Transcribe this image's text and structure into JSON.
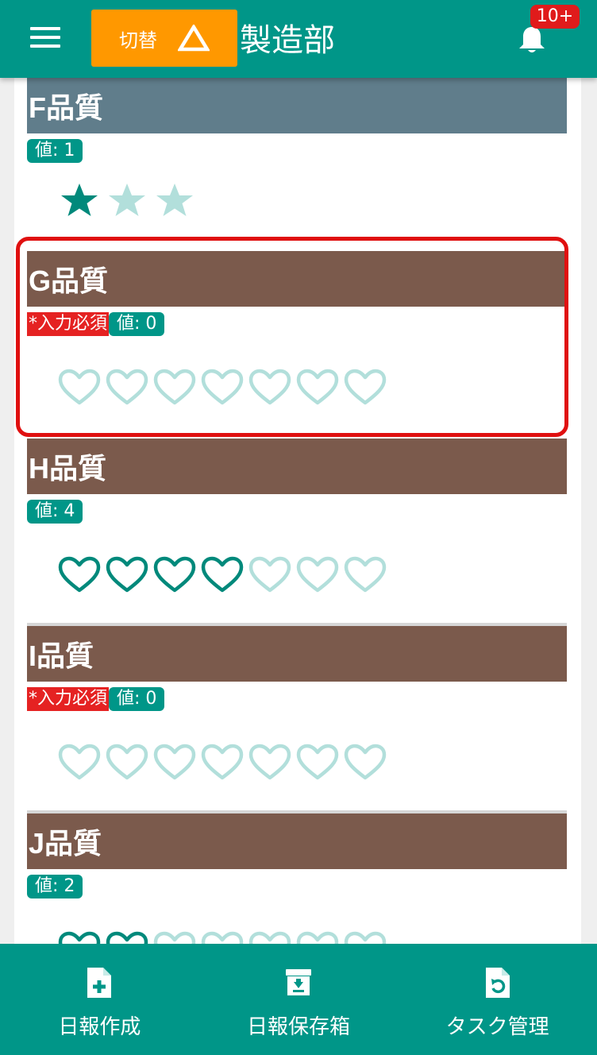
{
  "header": {
    "switch_label": "切替",
    "department": "製造部",
    "notification_badge": "10+"
  },
  "cards": [
    {
      "title": "F品質",
      "required": false,
      "value_label": "値: 1",
      "symbol": "star",
      "total": 3,
      "filled": 1
    },
    {
      "title": "G品質",
      "required": true,
      "required_label": "*入力必須",
      "value_label": "値: 0",
      "symbol": "heart",
      "total": 7,
      "filled": 0
    },
    {
      "title": "H品質",
      "required": false,
      "value_label": "値: 4",
      "symbol": "heart",
      "total": 7,
      "filled": 4
    },
    {
      "title": "I品質",
      "required": true,
      "required_label": "*入力必須",
      "value_label": "値: 0",
      "symbol": "heart",
      "total": 7,
      "filled": 0
    },
    {
      "title": "J品質",
      "required": false,
      "value_label": "値: 2",
      "symbol": "heart",
      "total": 7,
      "filled": 2
    }
  ],
  "bottom_nav": [
    {
      "label": "日報作成",
      "icon": "file-plus-icon"
    },
    {
      "label": "日報保存箱",
      "icon": "archive-box-icon"
    },
    {
      "label": "タスク管理",
      "icon": "file-refresh-icon"
    }
  ],
  "colors": {
    "primary": "#009688",
    "accent": "#ff9800",
    "card_header_brown": "#7b5a4c",
    "card_header_slate": "#607d8b",
    "required": "#e52222",
    "highlight": "#e01010"
  }
}
